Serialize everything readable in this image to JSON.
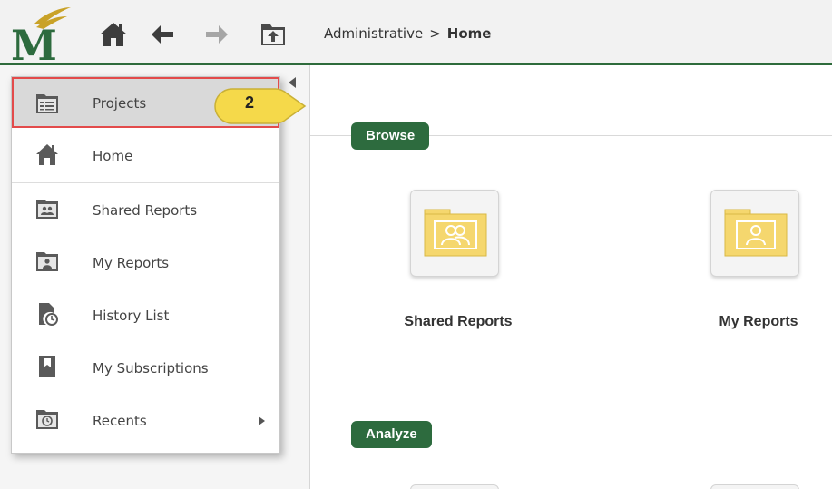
{
  "toolbar": {
    "logo_letter": "M",
    "breadcrumb": {
      "parent": "Administrative",
      "separator": ">",
      "current": "Home"
    },
    "icons": [
      "home-icon",
      "back-arrow-icon",
      "forward-arrow-icon",
      "up-folder-icon"
    ]
  },
  "menu": {
    "items": [
      {
        "label": "Projects",
        "icon": "projects-icon",
        "highlighted": true
      },
      {
        "label": "Home",
        "icon": "home-icon"
      },
      {
        "label": "Shared Reports",
        "icon": "shared-folder-icon"
      },
      {
        "label": "My Reports",
        "icon": "my-folder-icon"
      },
      {
        "label": "History List",
        "icon": "history-icon"
      },
      {
        "label": "My Subscriptions",
        "icon": "bookmark-icon"
      },
      {
        "label": "Recents",
        "icon": "recents-icon",
        "has_submenu": true
      }
    ]
  },
  "callout": {
    "number": "2"
  },
  "main": {
    "sections": [
      {
        "title": "Browse"
      },
      {
        "title": "Analyze"
      }
    ],
    "tiles": [
      {
        "label": "Shared Reports",
        "icon": "shared-folder-icon"
      },
      {
        "label": "My Reports",
        "icon": "my-folder-icon"
      }
    ]
  },
  "colors": {
    "brand_green": "#2d6b3e",
    "logo_gold": "#c9a227",
    "highlight_red": "#e34b4b",
    "callout_yellow": "#f5d94a",
    "folder_yellow": "#f5d76e"
  }
}
